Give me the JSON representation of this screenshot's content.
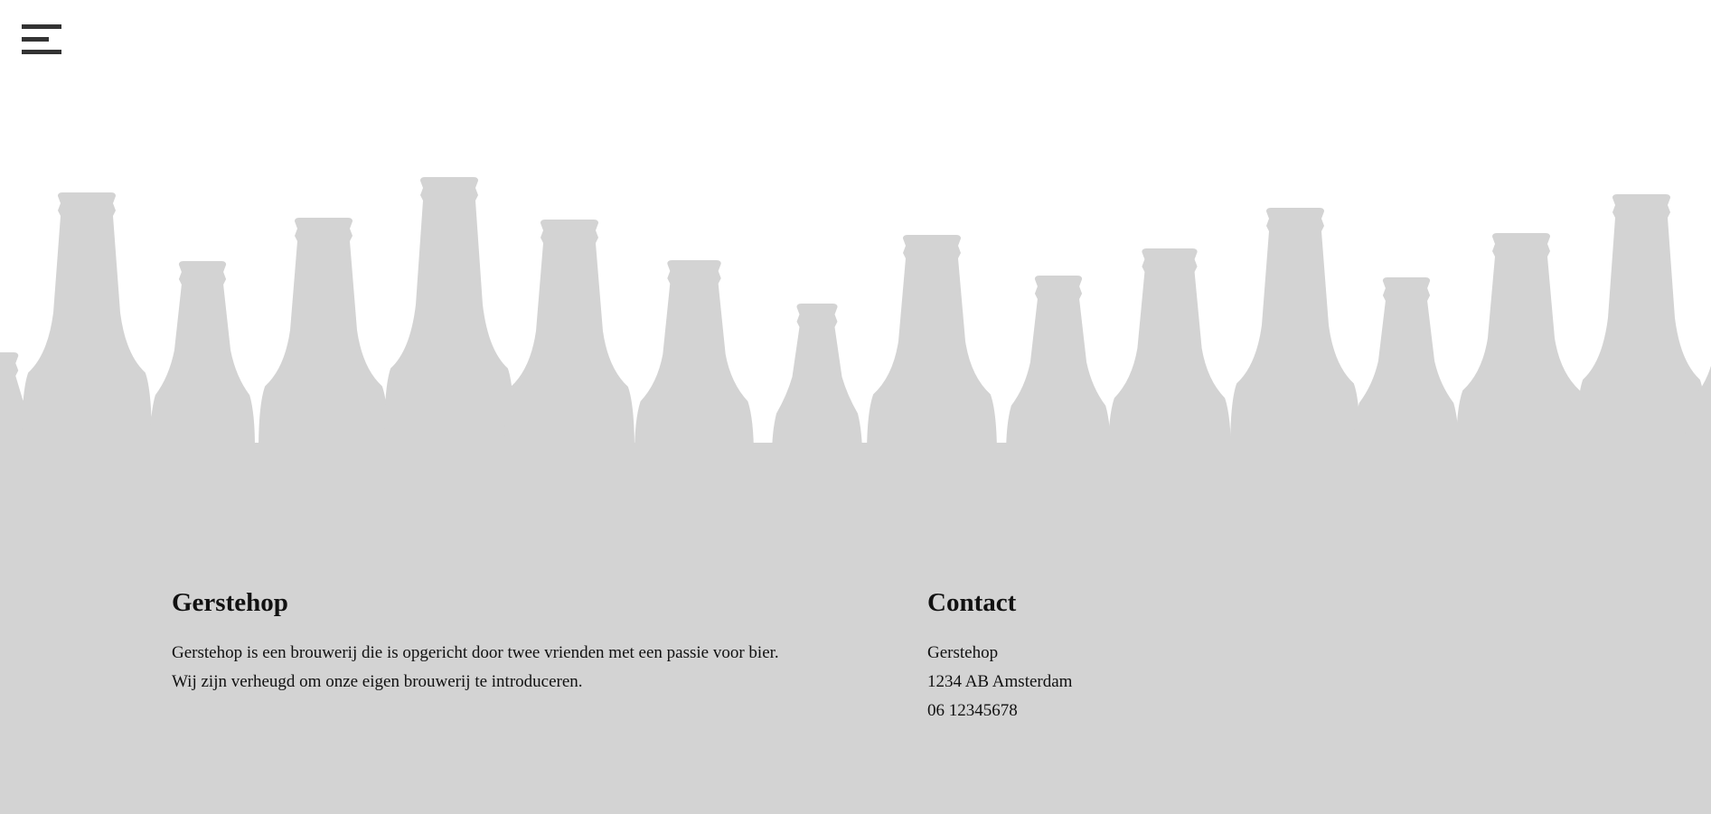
{
  "menu": {
    "icon": "hamburger-menu-icon"
  },
  "colors": {
    "footer_background": "#d3d3d3",
    "bottle_fill": "#d3d3d3",
    "menu_icon": "#333333"
  },
  "footer": {
    "about": {
      "title": "Gerstehop",
      "text": "Gerstehop is een brouwerij die is opgericht door twee vrienden met een passie voor bier. Wij zijn verheugd om onze eigen brouwerij te introduceren."
    },
    "contact": {
      "title": "Contact",
      "name": "Gerstehop",
      "address": "1234 AB Amsterdam",
      "phone": "06 12345678"
    }
  }
}
